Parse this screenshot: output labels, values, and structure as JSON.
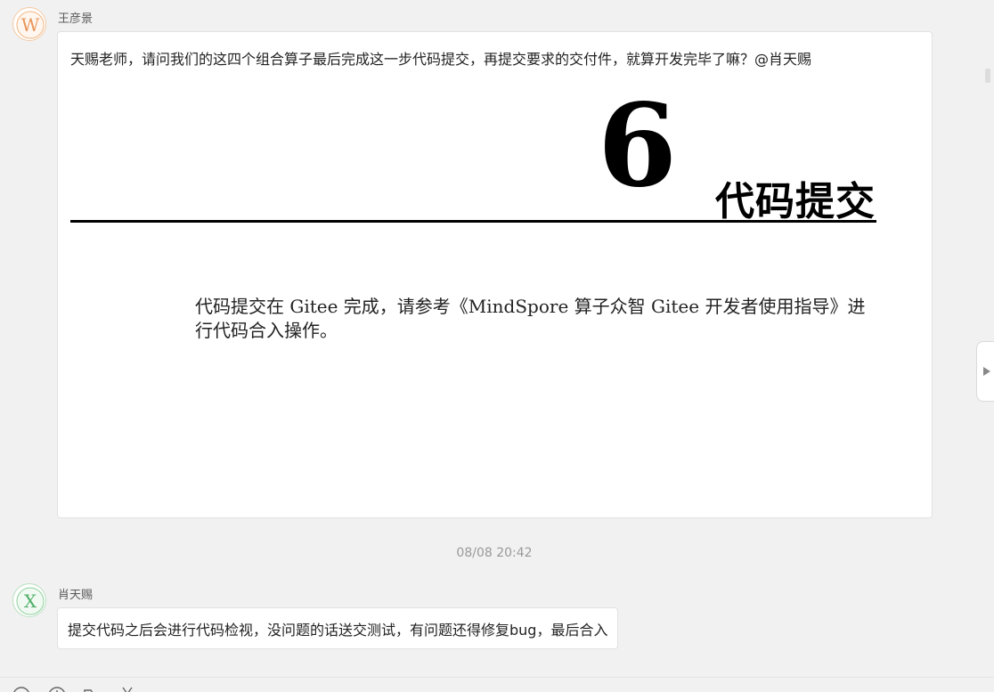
{
  "messages": [
    {
      "avatar_letter": "W",
      "sender": "王彦景",
      "text": "天赐老师，请问我们的这四个组合算子最后完成这一步代码提交，再提交要求的交付件，就算开发完毕了嘛？@肖天赐",
      "attachment": {
        "chapter_number": "6",
        "chapter_title": "代码提交",
        "body": "代码提交在 Gitee 完成，请参考《MindSpore  算子众智 Gitee 开发者使用指导》进行代码合入操作。"
      }
    },
    {
      "avatar_letter": "X",
      "sender": "肖天赐",
      "text": "提交代码之后会进行代码检视，没问题的话送交测试，有问题还得修复bug，最后合入"
    }
  ],
  "timestamp": "08/08 20:42",
  "colors": {
    "background": "#f1f1f1",
    "bubble": "#ffffff",
    "avatar_w": "#e8955a",
    "avatar_x": "#4fae68"
  },
  "toolbar": {
    "icons": [
      "emoji-icon",
      "clock-icon",
      "folder-icon",
      "scissors-icon"
    ]
  }
}
